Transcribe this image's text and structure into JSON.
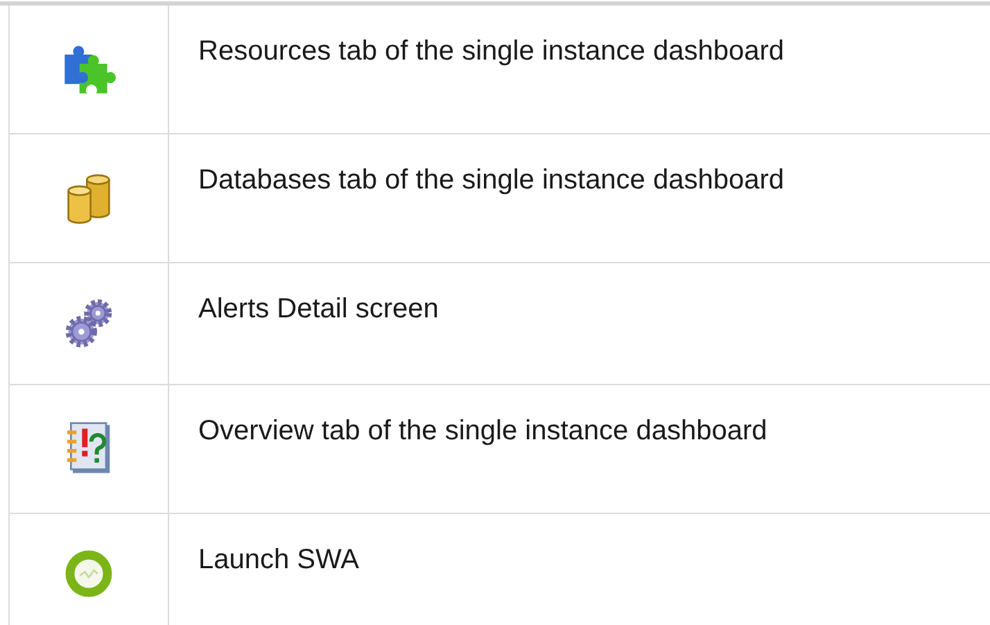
{
  "table": {
    "rows": [
      {
        "description": "Resources tab of the single instance dashboard"
      },
      {
        "description": "Databases tab of the single instance dashboard"
      },
      {
        "description": "Alerts Detail screen"
      },
      {
        "description": "Overview tab of the single instance dashboard"
      },
      {
        "description": "Launch SWA"
      }
    ]
  }
}
